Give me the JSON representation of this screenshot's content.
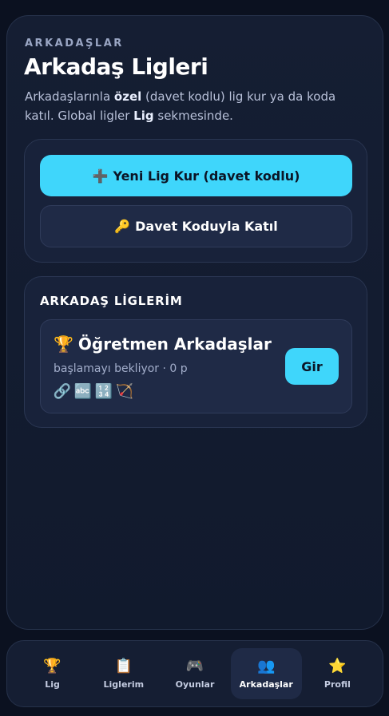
{
  "header": {
    "eyebrow": "ARKADAŞLAR",
    "title": "Arkadaş Ligleri",
    "description": {
      "part1": "Arkadaşlarınla ",
      "bold1": "özel",
      "part2": " (davet kodlu) lig kur ya da koda katıl. Global ligler ",
      "bold2": "Lig",
      "part3": " sekmesinde."
    }
  },
  "actions": {
    "create_icon": "➕",
    "create_label": "Yeni Lig Kur (davet kodlu)",
    "join_icon": "🔑",
    "join_label": "Davet Koduyla Katıl"
  },
  "my_leagues": {
    "title": "ARKADAŞ LİGLERİM",
    "items": [
      {
        "icon": "🏆",
        "name": "Öğretmen Arkadaşlar",
        "meta": "başlamayı bekliyor · 0 p",
        "badges": [
          "🔗",
          "🔤",
          "🔢",
          "🏹"
        ],
        "enter_label": "Gir"
      }
    ]
  },
  "bottom_nav": {
    "items": [
      {
        "icon": "🏆",
        "label": "Lig"
      },
      {
        "icon": "📋",
        "label": "Liglerim"
      },
      {
        "icon": "🎮",
        "label": "Oyunlar"
      },
      {
        "icon": "👥",
        "label": "Arkadaşlar"
      },
      {
        "icon": "⭐",
        "label": "Profil"
      }
    ],
    "active": "Arkadaşlar"
  },
  "colors": {
    "background": "#0b1120",
    "accent": "#3fd6fb",
    "card": "#18223a"
  }
}
